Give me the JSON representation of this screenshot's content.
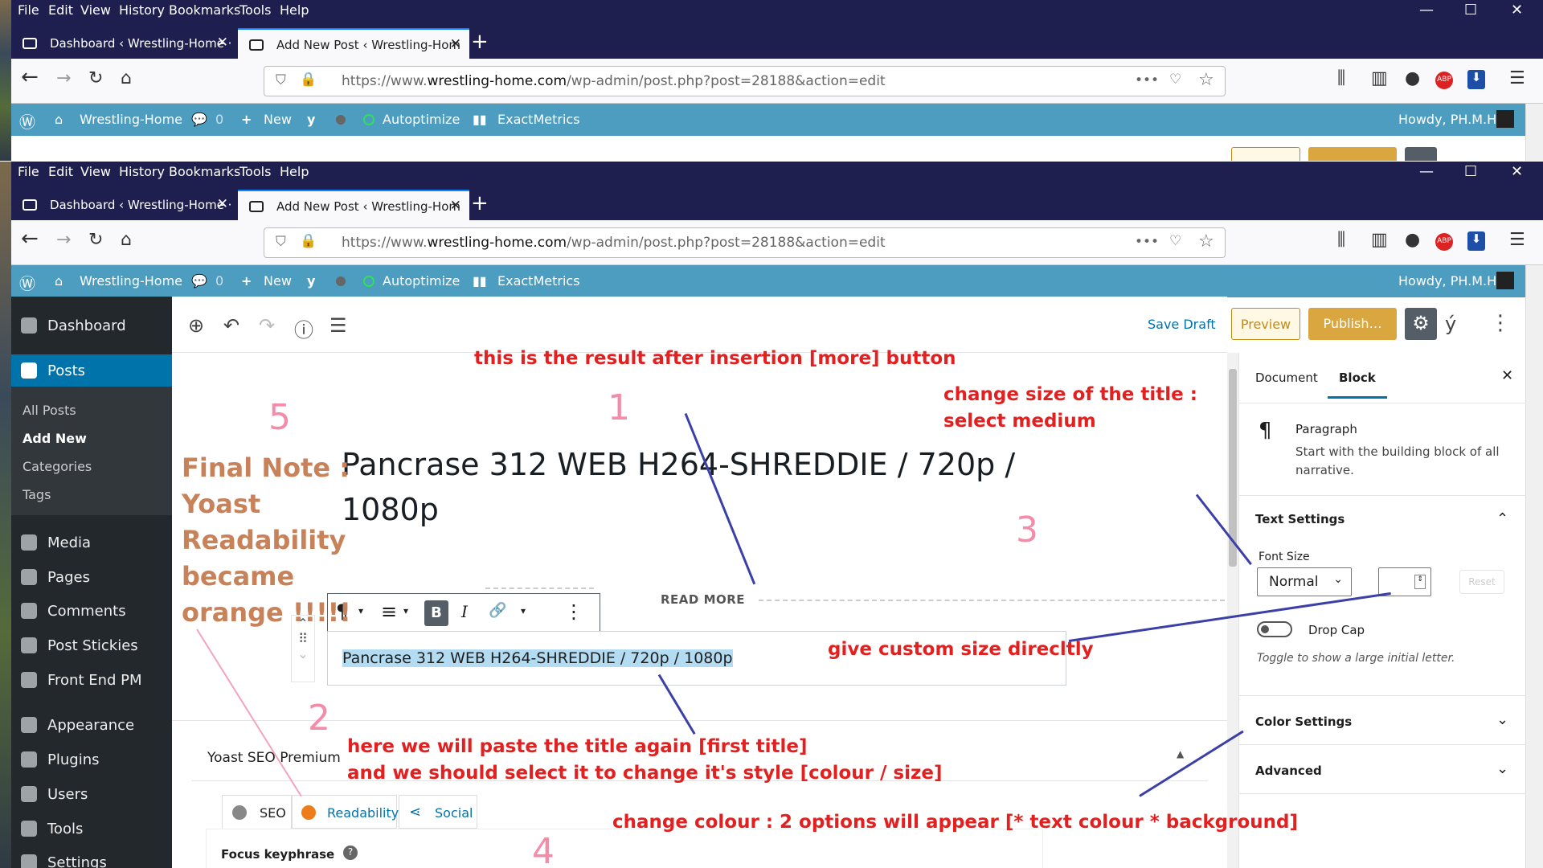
{
  "menu": [
    "File",
    "Edit",
    "View",
    "History",
    "Bookmarks",
    "Tools",
    "Help"
  ],
  "window_controls": {
    "minimize": "—",
    "maximize": "☐",
    "close": "✕"
  },
  "tabs": [
    {
      "label": "Dashboard ‹ Wrestling-Home ·"
    },
    {
      "label": "Add New Post ‹ Wrestling-Hom"
    }
  ],
  "tab_close": "✕",
  "new_tab": "+",
  "url": {
    "prefix": "https://www.",
    "host": "wrestling-home.com",
    "path": "/wp-admin/post.php?post=28188&action=edit"
  },
  "nav_icons": {
    "back": "←",
    "forward": "→",
    "reload": "↻",
    "home": "⌂",
    "more": "•••",
    "pocket": "♡",
    "star": "☆",
    "library": "⫼",
    "sidebar": "▥",
    "account": "●",
    "abp": "ABP",
    "download": "⬇",
    "menu": "☰"
  },
  "wpbar": {
    "site": "Wrestling-Home",
    "comments": "0",
    "new": "New",
    "autoptimize": "Autoptimize",
    "exactmetrics": "ExactMetrics",
    "howdy": "Howdy, PH.M.H"
  },
  "sidebar": {
    "dashboard": "Dashboard",
    "posts": "Posts",
    "sub": [
      "All Posts",
      "Add New",
      "Categories",
      "Tags"
    ],
    "items": [
      "Media",
      "Pages",
      "Comments",
      "Post Stickies",
      "Front End PM",
      "Appearance",
      "Plugins",
      "Users",
      "Tools",
      "Settings"
    ]
  },
  "editor": {
    "save_draft": "Save Draft",
    "preview": "Preview",
    "publish": "Publish…",
    "toolbar_icons": {
      "add": "⊕",
      "undo": "↶",
      "redo": "↷",
      "info": "ⓘ",
      "outline": "☰"
    },
    "title_line1": "Pancrase 312 WEB H264-SHREDDIE / 720p /",
    "title_line2": "1080p",
    "read_more": "READ MORE",
    "paragraph": "Pancrase 312 WEB H264-SHREDDIE / 720p / 1080p",
    "block_toolbar": {
      "para": "¶",
      "align": "≡",
      "bold": "B",
      "italic": "I",
      "link": "🔗",
      "more": "⋮",
      "caret": "▾"
    },
    "mover": {
      "up": "⌃",
      "drag": "⠿",
      "down": "⌄"
    }
  },
  "yoast": {
    "title": "Yoast SEO Premium",
    "tabs": [
      "SEO",
      "Readability",
      "Social"
    ],
    "focus": "Focus keyphrase",
    "toggle": "▲",
    "help": "?"
  },
  "panel": {
    "tab_document": "Document",
    "tab_block": "Block",
    "close": "✕",
    "block_name": "Paragraph",
    "block_desc": "Start with the building block of all narrative.",
    "text_settings": "Text Settings",
    "font_size": "Font Size",
    "font_value": "Normal",
    "reset": "Reset",
    "drop_cap": "Drop Cap",
    "drop_cap_help": "Toggle to show a large initial letter.",
    "color_settings": "Color Settings",
    "advanced": "Advanced",
    "chev_up": "⌃",
    "chev_down": "⌄"
  },
  "annotations": {
    "top": "this is the result after insertion [more] button",
    "size1": "change size of the title :",
    "size2": "select medium",
    "custom": "give custom size direcltly",
    "paste1": "here we will paste the title again [first title]",
    "paste2": "and we should select it to change it's style [colour / size]",
    "colour": "change colour : 2 options will appear [* text colour * background]",
    "note": [
      "Final Note :",
      "Yoast",
      "Readability",
      "became",
      "orange !!!!!"
    ],
    "nums": [
      "1",
      "2",
      "3",
      "4",
      "5"
    ]
  }
}
